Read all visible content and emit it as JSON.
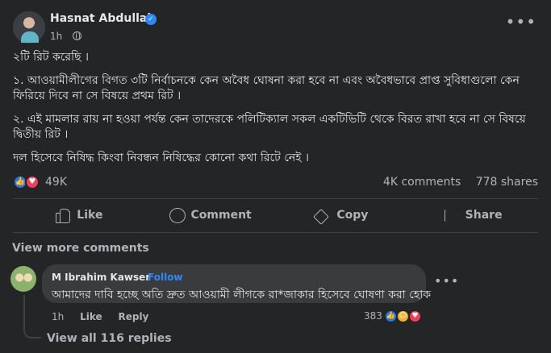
{
  "post": {
    "author": "Hasnat Abdullah",
    "time": "1h",
    "paragraphs": [
      "২টি রিট করেছি ।",
      "১. আওয়ামীলীগের বিগত ৩টি নির্বাচনকে কেন অবৈধ ঘোষনা করা হবে না এবং অবৈধভাবে প্রাপ্ত সুবিধাগুলো কেন ফিরিয়ে দিবে না সে বিষয়ে প্রথম রিট ।",
      "২. এই মামলার রায় না হওয়া পর্যন্ত কেন তাদেরকে পলিটিক্যাল সকল একটিভিটি থেকে বিরত রাখা হবে না সে বিষয়ে দ্বিতীয় রিট ।",
      "দল হিসেবে নিষিদ্ধ কিংবা নিবন্ধন নিষিদ্ধের কোনো কথা রিটে নেই ।"
    ]
  },
  "stats": {
    "reaction_count": "49K",
    "comments": "4K comments",
    "shares": "778 shares"
  },
  "actions": {
    "like": "Like",
    "comment": "Comment",
    "copy": "Copy",
    "share": "Share"
  },
  "comments_section": {
    "view_more": "View more comments",
    "comment": {
      "name": "M Ibrahim Kawser",
      "separator": "·",
      "follow": "Follow",
      "text": "আমাদের দাবি হচ্ছে অতি দ্রুত আওয়ামী লীগকে রা*জাকার হিসেবে ঘোষণা করা হোক",
      "time": "1h",
      "like": "Like",
      "reply": "Reply",
      "reaction_count": "383"
    },
    "view_replies": "View all 116 replies"
  },
  "colors": {
    "background": "#242526",
    "bubble": "#3a3b3c",
    "link_blue": "#2d88ff",
    "like_blue": "#2078f4",
    "love_red": "#f33e58",
    "haha_yellow": "#f7b125"
  }
}
